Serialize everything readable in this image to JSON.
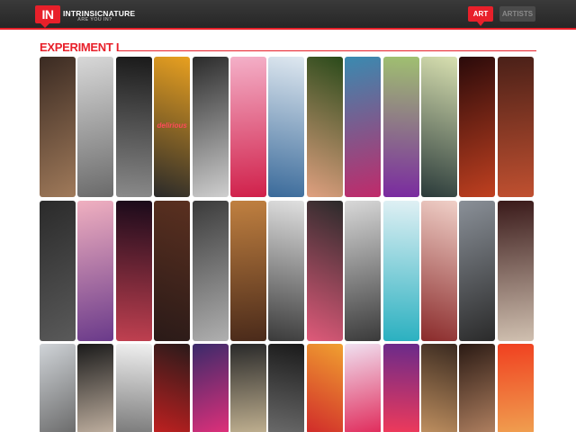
{
  "header": {
    "logo_mark": "IN",
    "logo_title": "INTRINSICNATURE",
    "logo_tagline": "ARE YOU IN?",
    "nav": [
      {
        "label": "ART",
        "active": true
      },
      {
        "label": "ARTISTS",
        "active": false
      }
    ]
  },
  "section": {
    "title": "EXPERIMENT I"
  },
  "colors": {
    "accent": "#e8202a",
    "topbar": "#2b2b2b"
  },
  "gallery": {
    "rows": [
      {
        "tiles": [
          {
            "c1": "#3a2a22",
            "c2": "#a07a5a"
          },
          {
            "c1": "#d8d8d8",
            "c2": "#6a6a6a"
          },
          {
            "c1": "#1a1a1a",
            "c2": "#8a8a8a"
          },
          {
            "c1": "#e8a020",
            "c2": "#2a2a2a",
            "text": "delirious"
          },
          {
            "c1": "#2a2a2a",
            "c2": "#cfcfcf"
          },
          {
            "c1": "#f4b0c8",
            "c2": "#d0204a"
          },
          {
            "c1": "#dfe8f0",
            "c2": "#3a6a9a"
          },
          {
            "c1": "#2a4a1a",
            "c2": "#e0a080"
          },
          {
            "c1": "#3a8ab0",
            "c2": "#c02a6a"
          },
          {
            "c1": "#a0c070",
            "c2": "#7a2aa0"
          },
          {
            "c1": "#d8e0b0",
            "c2": "#2a3a3a"
          },
          {
            "c1": "#2a0a0a",
            "c2": "#c04020"
          },
          {
            "c1": "#4a2018",
            "c2": "#c05030"
          }
        ]
      },
      {
        "tiles": [
          {
            "c1": "#2a2a2a",
            "c2": "#5a5a5a"
          },
          {
            "c1": "#f0b0c0",
            "c2": "#6a3a8a"
          },
          {
            "c1": "#1a0a1a",
            "c2": "#c04050"
          },
          {
            "c1": "#5a3020",
            "c2": "#2a1a18"
          },
          {
            "c1": "#3a3a3a",
            "c2": "#b0b0b0"
          },
          {
            "c1": "#c08040",
            "c2": "#4a2a1a"
          },
          {
            "c1": "#e0e0e0",
            "c2": "#3a3a3a"
          },
          {
            "c1": "#2a2a2a",
            "c2": "#e05a7a"
          },
          {
            "c1": "#d8d8d8",
            "c2": "#3a3a3a"
          },
          {
            "c1": "#e0f0f4",
            "c2": "#2ab0c0"
          },
          {
            "c1": "#f0d0c8",
            "c2": "#8a2a2a"
          },
          {
            "c1": "#8a9098",
            "c2": "#2a2a2a"
          },
          {
            "c1": "#3a1a1a",
            "c2": "#d0c0b0"
          }
        ]
      },
      {
        "tiles": [
          {
            "c1": "#d0d4d8",
            "c2": "#6a6a6a"
          },
          {
            "c1": "#1a1a1a",
            "c2": "#c0b0a0"
          },
          {
            "c1": "#f0f0f0",
            "c2": "#7a7a7a"
          },
          {
            "c1": "#2a1a1a",
            "c2": "#c02020"
          },
          {
            "c1": "#3a2a6a",
            "c2": "#e0307a"
          },
          {
            "c1": "#2a2a2a",
            "c2": "#c0b090"
          },
          {
            "c1": "#1a1a1a",
            "c2": "#6a6a6a"
          },
          {
            "c1": "#f0a030",
            "c2": "#d02a2a"
          },
          {
            "c1": "#f0e0f0",
            "c2": "#e02a5a"
          },
          {
            "c1": "#6a2a8a",
            "c2": "#f03a5a"
          },
          {
            "c1": "#3a2a20",
            "c2": "#c09060"
          },
          {
            "c1": "#2a1a14",
            "c2": "#b08060"
          },
          {
            "c1": "#f04020",
            "c2": "#f0a050"
          }
        ]
      }
    ]
  }
}
